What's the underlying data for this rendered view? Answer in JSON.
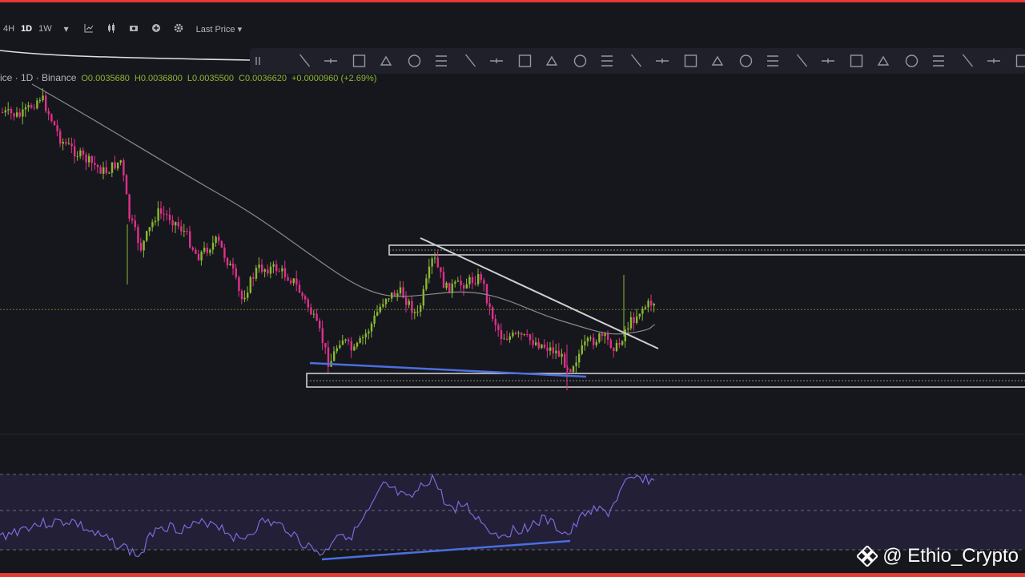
{
  "toolbar": {
    "timeframes": [
      "4H",
      "1D",
      "1W"
    ],
    "active_timeframe": "1D",
    "price_type": "Last Price",
    "icons": [
      "chevron-down-icon",
      "indicators-icon",
      "candles-icon",
      "camera-icon",
      "plus-circle-icon",
      "gear-icon"
    ]
  },
  "legend": {
    "symbol": "ice · 1D · Binance",
    "open": "O0.0035680",
    "high": "H0.0036800",
    "low": "L0.0035500",
    "close": "C0.0036620",
    "change": "+0.0000960 (+2.69%)"
  },
  "drawing_tools": [
    "drag-handle-icon",
    "trend-line-icon",
    "ray-icon",
    "horizontal-ray-icon",
    "horizontal-line-icon",
    "vertical-line-icon",
    "arrow-icon",
    "brush-icon",
    "arrow-up-icon",
    "arrow-down-icon",
    "arrow-left-icon",
    "arrow-right-icon",
    "pencil-icon",
    "rectangle-icon",
    "polyline-icon",
    "path-icon",
    "circle-icon",
    "ellipse-icon",
    "parallel-channel-icon",
    "fib-retracement-icon",
    "price-range-icon",
    "date-range-icon",
    "date-price-range-icon",
    "flag-icon",
    "callout-icon",
    "balloon-icon",
    "comment-icon",
    "text-icon",
    "more-icon"
  ],
  "watermark": {
    "handle": "@ Ethio_Crypto",
    "icon": "binance-logo-icon"
  },
  "colors": {
    "up": "#8ab832",
    "down": "#e0308a",
    "support": "#4b6fe0",
    "resistance_box": "#d8d8d8",
    "rsi": "#7b6cd9",
    "frame": "#e53935"
  },
  "chart_data": {
    "type": "candlestick",
    "price_levels": {
      "resistance": 0.00395,
      "support": 0.0033,
      "current": 0.003662
    },
    "ohlc_last": {
      "open": 0.003568,
      "high": 0.00368,
      "low": 0.00355,
      "close": 0.003662
    },
    "rsi_bands": [
      70,
      50,
      30
    ]
  }
}
